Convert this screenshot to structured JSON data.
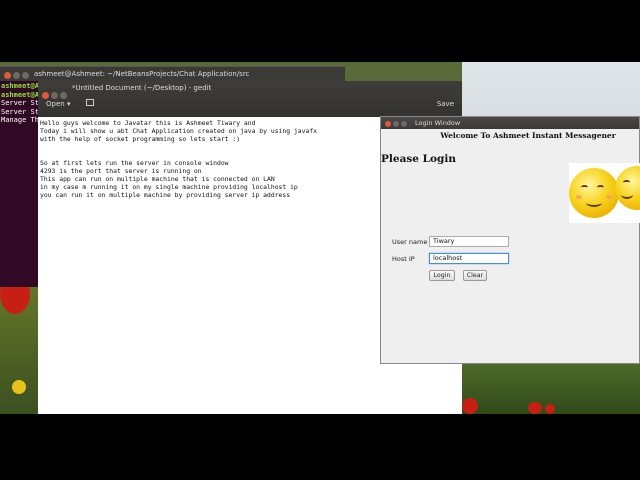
{
  "terminal": {
    "title": "ashmeet@Ashmeet: ~/NetBeansProjects/Chat Application/src",
    "lines": [
      {
        "prompt": "ashmeet@A",
        "rest": ""
      },
      {
        "prompt": "ashmeet@A",
        "rest": ""
      },
      {
        "prompt": "",
        "rest": "Server St"
      },
      {
        "prompt": "",
        "rest": "Server St"
      },
      {
        "prompt": "",
        "rest": "Manage Th"
      }
    ]
  },
  "gedit": {
    "title": "*Untitled Document (~/Desktop) - gedit",
    "open_label": "Open",
    "save_label": "Save",
    "text": "Hello guys welcome to Javatar this is Ashmeet Tiwary and\nToday i will show u abt Chat Application created on java by using javafx\nwith the help of socket programming so lets start :)\n\n\nSo at first lets run the server in console window\n4293 is the port that server is running on\nThis app can run on multiple machine that is connected on LAN\nin my case m running it on my single machine providing localhost ip\nyou can run it on multiple machine by providing server ip address"
  },
  "login": {
    "window_title": "Login Window",
    "welcome": "Welcome To Ashmeet Instant Messagener",
    "heading": "Please Login",
    "username_label": "User name",
    "username_value": "Tiwary",
    "host_label": "Host IP",
    "host_value": "localhost",
    "login_button": "Login",
    "clear_button": "Clear"
  },
  "icons": [
    "close-icon",
    "minimize-icon",
    "maximize-icon",
    "new-document-icon",
    "chevron-down-icon",
    "smiley-icon"
  ]
}
